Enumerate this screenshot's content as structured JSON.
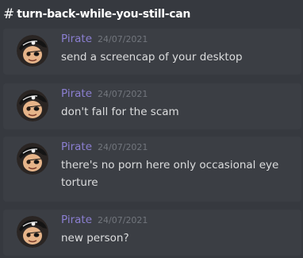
{
  "channel": {
    "hash_symbol": "#",
    "name": "turn-back-while-you-still-can"
  },
  "messages": [
    {
      "author": "Pirate",
      "timestamp": "24/07/2021",
      "content": "send a screencap of your desktop",
      "avatar_icon": "pirate-avatar-icon"
    },
    {
      "author": "Pirate",
      "timestamp": "24/07/2021",
      "content": "don't fall for the scam",
      "avatar_icon": "pirate-avatar-icon"
    },
    {
      "author": "Pirate",
      "timestamp": "24/07/2021",
      "content": "there's no porn here only occasional eye torture",
      "avatar_icon": "pirate-avatar-icon"
    },
    {
      "author": "Pirate",
      "timestamp": "24/07/2021",
      "content": "new person?",
      "avatar_icon": "pirate-avatar-icon"
    }
  ],
  "colors": {
    "background": "#36393f",
    "message_background": "#3b3e44",
    "author": "#8b7fd1",
    "timestamp": "#72767d",
    "text": "#dcddde",
    "header_text": "#ffffff"
  }
}
